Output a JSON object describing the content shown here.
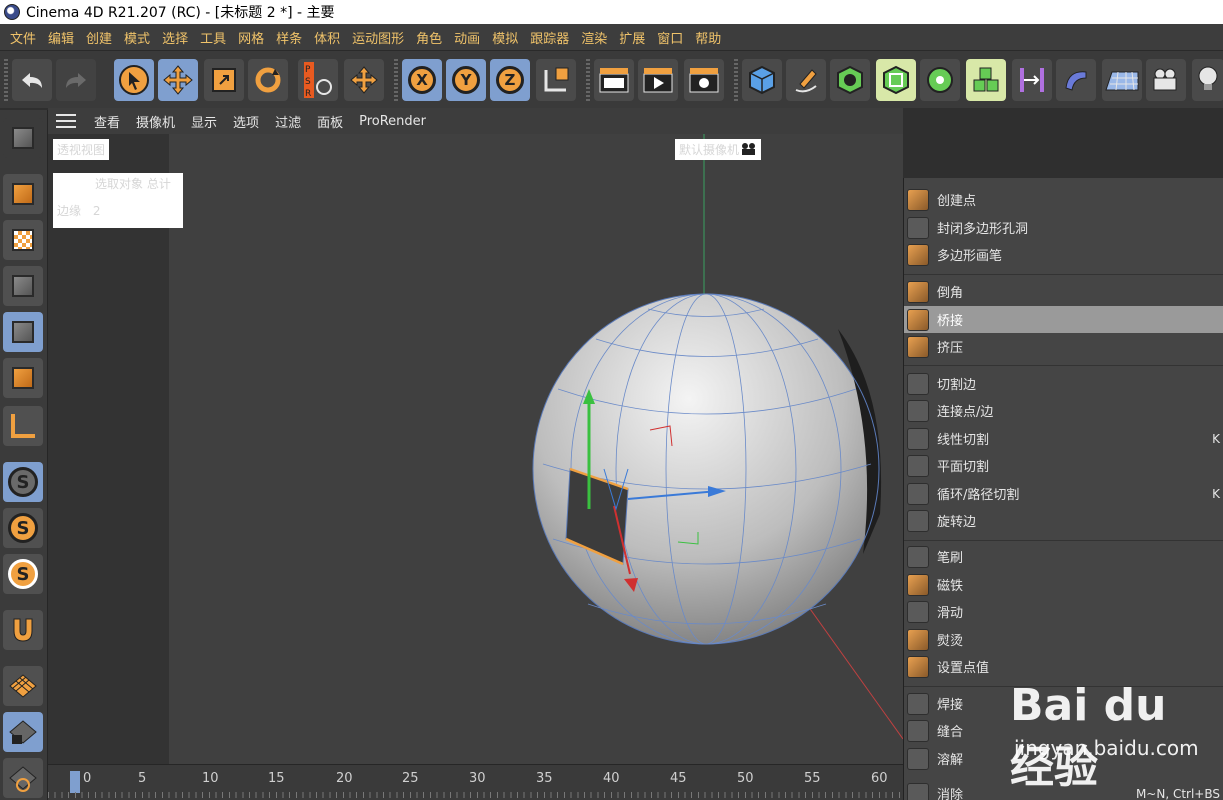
{
  "window": {
    "title": "Cinema 4D R21.207 (RC) - [未标题 2 *] - 主要"
  },
  "menubar": {
    "items": [
      "文件",
      "编辑",
      "创建",
      "模式",
      "选择",
      "工具",
      "网格",
      "样条",
      "体积",
      "运动图形",
      "角色",
      "动画",
      "模拟",
      "跟踪器",
      "渲染",
      "扩展",
      "窗口",
      "帮助"
    ]
  },
  "toolbar": {
    "undo": "undo-icon",
    "redo": "redo-icon",
    "tools": [
      "select-arrow-icon",
      "move-icon",
      "scale-icon",
      "rotate-icon",
      "psr-icon",
      "move-extra-icon"
    ],
    "axis": [
      "X",
      "Y",
      "Z"
    ],
    "psr_label": "PSR",
    "accent": "#7f9fcf"
  },
  "viewport": {
    "menus": [
      "查看",
      "摄像机",
      "显示",
      "选项",
      "过滤",
      "面板",
      "ProRender"
    ],
    "view_name": "透视视图",
    "camera_name": "默认摄像机",
    "stats_header": "选取对象  总计",
    "stats_row_label": "边缘",
    "stats_row_value": "2"
  },
  "context_menu": {
    "items": [
      {
        "label": "创建点",
        "shortcut": ""
      },
      {
        "label": "封闭多边形孔洞",
        "shortcut": ""
      },
      {
        "label": "多边形画笔",
        "shortcut": ""
      },
      {
        "label": "倒角",
        "shortcut": ""
      },
      {
        "label": "桥接",
        "shortcut": ""
      },
      {
        "label": "挤压",
        "shortcut": ""
      },
      {
        "label": "切割边",
        "shortcut": ""
      },
      {
        "label": "连接点/边",
        "shortcut": ""
      },
      {
        "label": "线性切割",
        "shortcut": "K"
      },
      {
        "label": "平面切割",
        "shortcut": ""
      },
      {
        "label": "循环/路径切割",
        "shortcut": "K"
      },
      {
        "label": "旋转边",
        "shortcut": ""
      },
      {
        "label": "笔刷",
        "shortcut": ""
      },
      {
        "label": "磁铁",
        "shortcut": ""
      },
      {
        "label": "滑动",
        "shortcut": ""
      },
      {
        "label": "熨烫",
        "shortcut": ""
      },
      {
        "label": "设置点值",
        "shortcut": ""
      },
      {
        "label": "焊接",
        "shortcut": ""
      },
      {
        "label": "缝合",
        "shortcut": ""
      },
      {
        "label": "溶解",
        "shortcut": ""
      },
      {
        "label": "消除",
        "shortcut": "M~N, Ctrl+BS"
      }
    ],
    "highlighted": "桥接"
  },
  "timeline": {
    "ticks": [
      "0",
      "5",
      "10",
      "15",
      "20",
      "25",
      "30",
      "35",
      "40",
      "45",
      "50",
      "55",
      "60"
    ]
  },
  "watermark": {
    "logo": "Bai du 经验",
    "url": "jingyan.baidu.com"
  }
}
